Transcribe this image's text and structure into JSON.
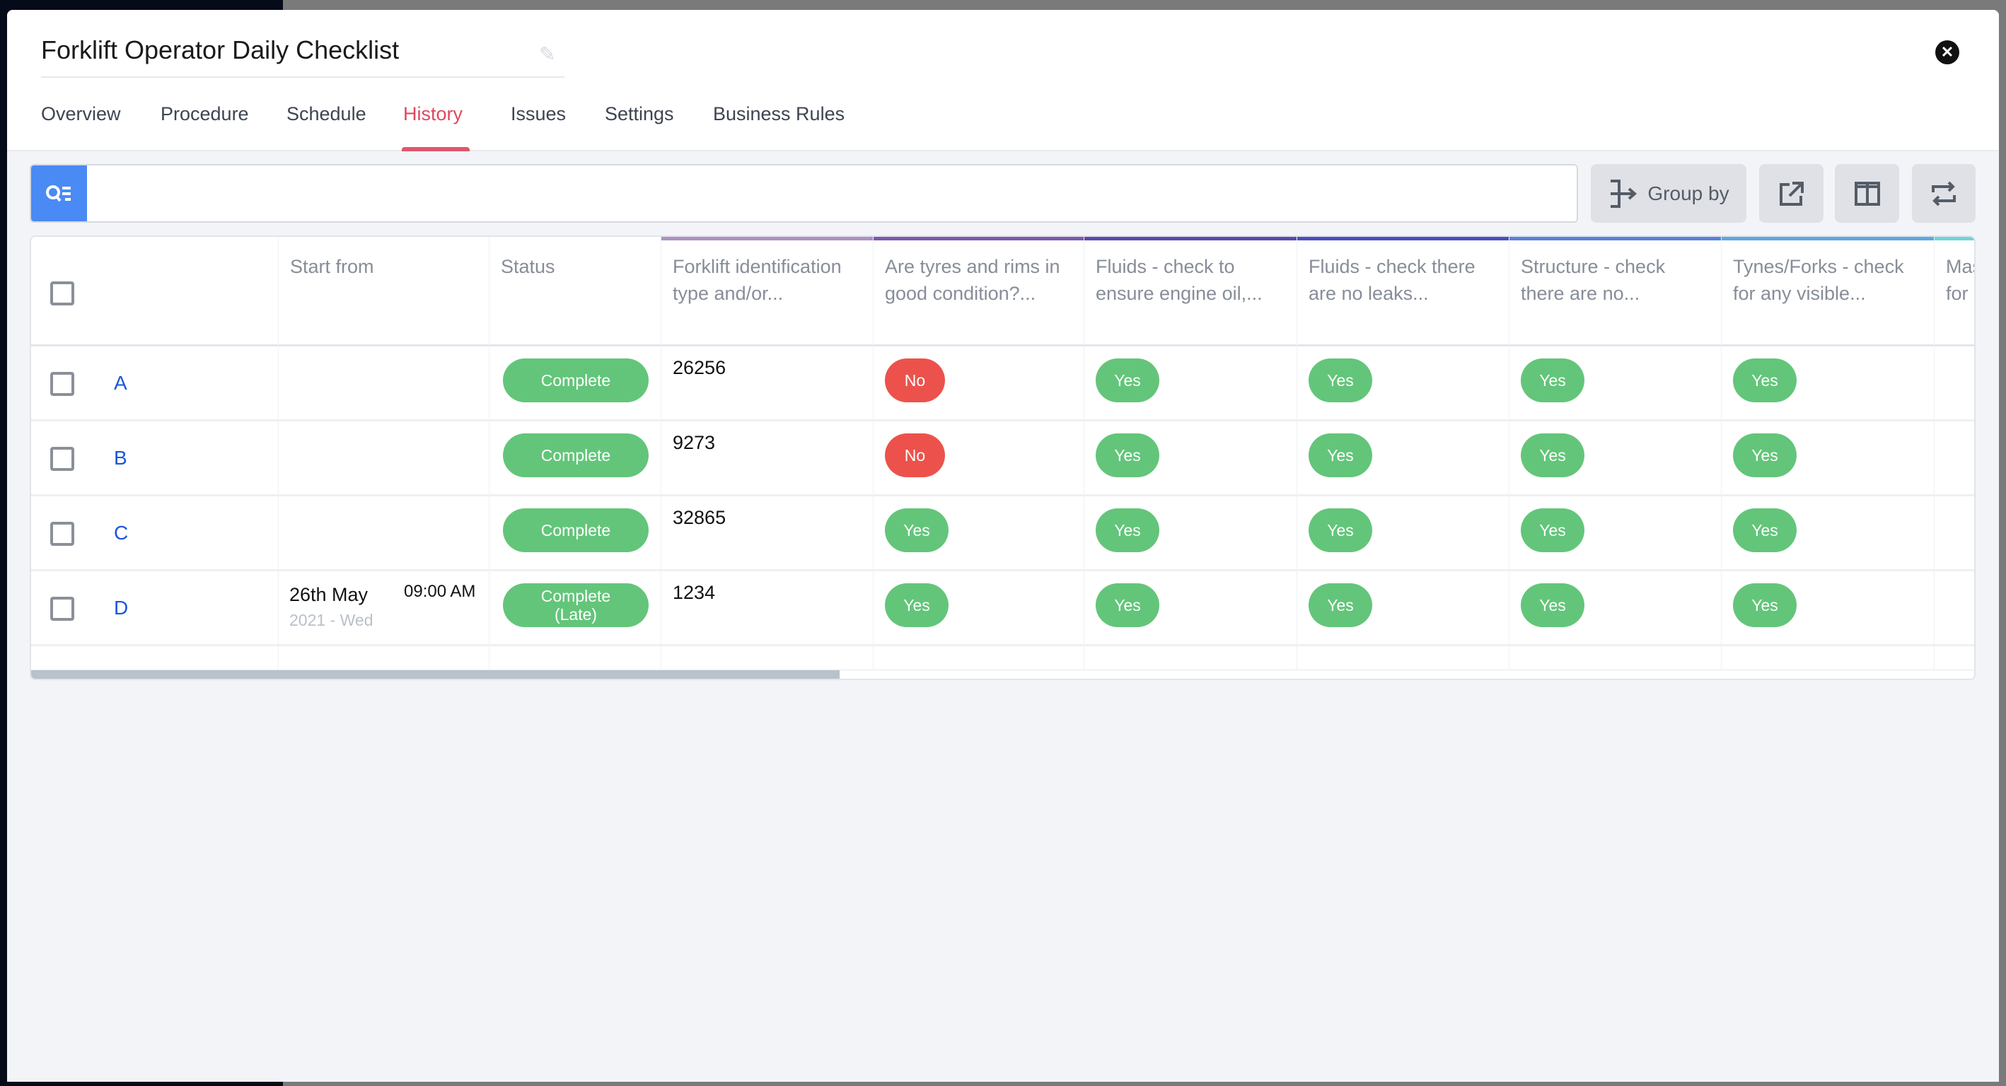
{
  "window": {
    "title": "Forklift Operator Daily Checklist"
  },
  "tabs": [
    {
      "label": "Overview"
    },
    {
      "label": "Procedure"
    },
    {
      "label": "Schedule"
    },
    {
      "label": "History",
      "active": true
    },
    {
      "label": "Issues"
    },
    {
      "label": "Settings"
    },
    {
      "label": "Business Rules"
    }
  ],
  "search": {
    "value": "",
    "placeholder": ""
  },
  "toolbar": {
    "group_by_label": "Group by",
    "icons": [
      "group-by-icon",
      "export-icon",
      "columns-icon",
      "swap-icon"
    ]
  },
  "colors": {
    "accent": "#e0475f",
    "search": "#4a8af4",
    "yes": "#63c57a",
    "no": "#ec524b",
    "link": "#1a56db"
  },
  "table": {
    "columns": [
      {
        "label": ""
      },
      {
        "label": "Start from"
      },
      {
        "label": "Status"
      },
      {
        "label": "Forklift identification type and/or...",
        "color": "#ad8fc3"
      },
      {
        "label": "Are tyres and rims in good condition?...",
        "color": "#7b58ae"
      },
      {
        "label": "Fluids - check to ensure engine oil,...",
        "color": "#5b48ad"
      },
      {
        "label": "Fluids - check there are no leaks...",
        "color": "#4a4dbf"
      },
      {
        "label": "Structure - check there are no...",
        "color": "#5b80da"
      },
      {
        "label": "Tynes/Forks - check for any visible...",
        "color": "#5ba9de"
      },
      {
        "label": "Mas for",
        "color": "#6dd5da"
      }
    ],
    "rows": [
      {
        "id": "A",
        "date": "",
        "time": "",
        "date_sub": "",
        "status": "Complete",
        "forklift": "26256",
        "answers": [
          "No",
          "Yes",
          "Yes",
          "Yes",
          "Yes"
        ]
      },
      {
        "id": "B",
        "date": "",
        "time": "",
        "date_sub": "",
        "status": "Complete",
        "forklift": "9273",
        "answers": [
          "No",
          "Yes",
          "Yes",
          "Yes",
          "Yes"
        ]
      },
      {
        "id": "C",
        "date": "",
        "time": "",
        "date_sub": "",
        "status": "Complete",
        "forklift": "32865",
        "answers": [
          "Yes",
          "Yes",
          "Yes",
          "Yes",
          "Yes"
        ]
      },
      {
        "id": "D",
        "date": "26th May",
        "time": "09:00 AM",
        "date_sub": "2021 - Wed",
        "status": "Complete (Late)",
        "forklift": "1234",
        "answers": [
          "Yes",
          "Yes",
          "Yes",
          "Yes",
          "Yes"
        ]
      }
    ],
    "scroll_position_percent": 23
  }
}
